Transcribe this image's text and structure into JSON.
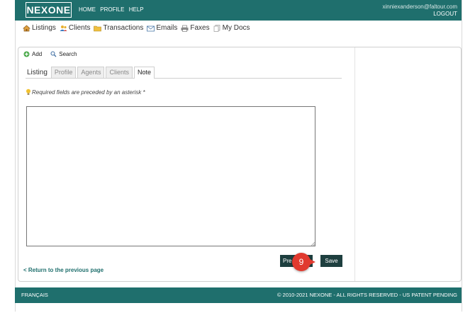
{
  "header": {
    "logo": "NEXONE",
    "nav": [
      "HOME",
      "PROFILE",
      "HELP"
    ],
    "user_email": "xinniexanderson@faltour.com",
    "logout": "LOGOUT",
    "bg_color": "#1f6f6d"
  },
  "main_nav": [
    {
      "label": "Listings",
      "icon": "house-icon"
    },
    {
      "label": "Clients",
      "icon": "people-icon"
    },
    {
      "label": "Transactions",
      "icon": "folder-icon"
    },
    {
      "label": "Emails",
      "icon": "envelope-icon"
    },
    {
      "label": "Faxes",
      "icon": "printer-icon"
    },
    {
      "label": "My Docs",
      "icon": "documents-icon"
    }
  ],
  "toolbar": {
    "add_label": "Add",
    "search_label": "Search"
  },
  "tabs": {
    "listing": "Listing",
    "profile": "Profile",
    "agents": "Agents",
    "clients": "Clients",
    "note": "Note"
  },
  "form": {
    "required_hint": "Required fields are preceded by an asterisk *",
    "note_value": ""
  },
  "buttons": {
    "previous_label": "Pre",
    "save_label": "Save",
    "step_badge": "9"
  },
  "return_link": "< Return to the previous page",
  "footer": {
    "language": "FRANÇAIS",
    "copyright": "© 2010-2021 NEXONE - ALL RIGHTS RESERVED - US PATENT PENDING"
  }
}
